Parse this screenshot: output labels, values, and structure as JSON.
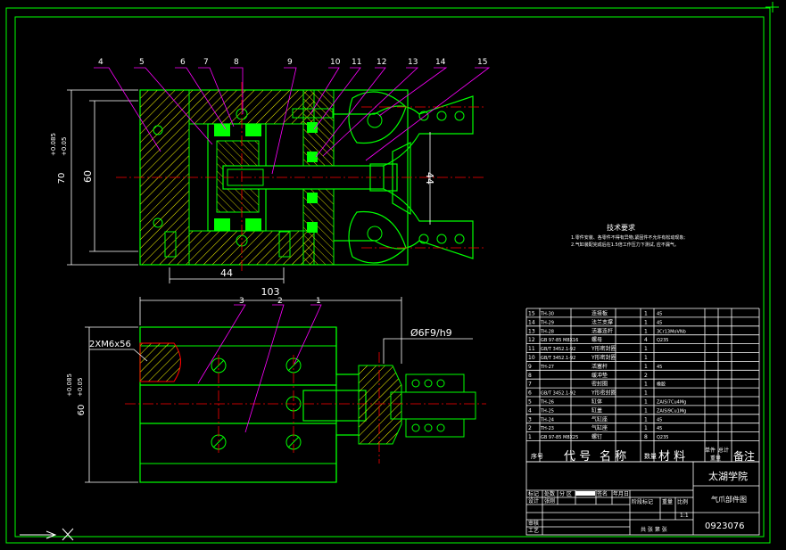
{
  "colors": {
    "background": "#000000",
    "frame": "#00ff00",
    "part": "#ffffff",
    "hatch": "#ffff00",
    "leader": "#ff00ff",
    "centerline": "#ff0000",
    "dimension": "#ffffff",
    "text": "#ffffff"
  },
  "callouts": [
    "4",
    "5",
    "6",
    "7",
    "8",
    "9",
    "10",
    "11",
    "12",
    "13",
    "14",
    "15"
  ],
  "section_callouts": [
    "3",
    "2",
    "1"
  ],
  "dimensions": {
    "height_tol": "70 ",
    "tol_upper": "+0.085",
    "tol_lower": "+0.05",
    "height_60": "60",
    "bore_44_v": "44",
    "base_44_h": "44",
    "overall_103": "103",
    "thread": "2XM6x56",
    "fit": "Ø6F9/h9",
    "lower_height": "60",
    "lower_tol_upper": "+0.085",
    "lower_tol_lower": "+0.05"
  },
  "notes": {
    "title": "技术要求",
    "line1": "1.零件安装、各零件不得有异物,紧固件不允许有松动现象;",
    "line2": "2.气缸装配完成后在1.5倍工作压力下测试, 应不漏气。"
  },
  "bom": {
    "rows": [
      [
        "15",
        "TH-30",
        "连接板",
        "1",
        "45",
        ""
      ],
      [
        "14",
        "TH-29",
        "法兰支撑",
        "1",
        "45",
        ""
      ],
      [
        "13",
        "TH-28",
        "活塞连杆",
        "1",
        "3Cr13MoVNb",
        ""
      ],
      [
        "12",
        "GB 97-85 M8X16",
        "螺母",
        "4",
        "Q235",
        ""
      ],
      [
        "11",
        "GB/T 3452.1-92",
        "Y形密封圈",
        "1",
        "",
        ""
      ],
      [
        "10",
        "GB/T 3452.1-92",
        "Y形密封圈",
        "1",
        "",
        ""
      ],
      [
        "9",
        "TH-27",
        "活塞杆",
        "1",
        "45",
        ""
      ],
      [
        "8",
        "",
        "缓冲垫",
        "2",
        "",
        ""
      ],
      [
        "7",
        "",
        "密封圈",
        "1",
        "橡胶",
        ""
      ],
      [
        "6",
        "GB/T 3452.1-92",
        "Y形密封圈",
        "1",
        "",
        ""
      ],
      [
        "5",
        "TH-26",
        "缸体",
        "1",
        "ZAlSi7Cu4Mg",
        ""
      ],
      [
        "4",
        "TH-25",
        "缸盖",
        "1",
        "ZAlSi9Cu1Mg",
        ""
      ],
      [
        "3",
        "TH-24",
        "气缸座",
        "1",
        "45",
        ""
      ],
      [
        "2",
        "TH-23",
        "气缸座",
        "1",
        "45",
        ""
      ],
      [
        "1",
        "GB 97-85 M8X25",
        "螺钉",
        "8",
        "Q235",
        ""
      ]
    ],
    "header": {
      "seq": "序号",
      "code": "代 号",
      "name": "名 称",
      "qty": "数量",
      "material": "材 料",
      "single_weight": "单件",
      "total_weight": "总计",
      "weight": "重量",
      "remark": "备注"
    }
  },
  "title_block": {
    "school": "太湖学院",
    "drawing_name": "气爪部件图",
    "drawing_no": "0923076",
    "mark": "标记",
    "count": "处数",
    "zone": "分 区",
    "change_doc": "更改文件号",
    "sign": "签名",
    "date": "年月日",
    "design": "设计",
    "designer": "张刚",
    "standardize": "标准化",
    "stage_mark": "阶段标记",
    "weight": "重量",
    "scale": "比例",
    "scale_value": "1:1",
    "review": "审核",
    "process": "工艺",
    "approve": "批准",
    "sheets": "共   张   第   张"
  }
}
